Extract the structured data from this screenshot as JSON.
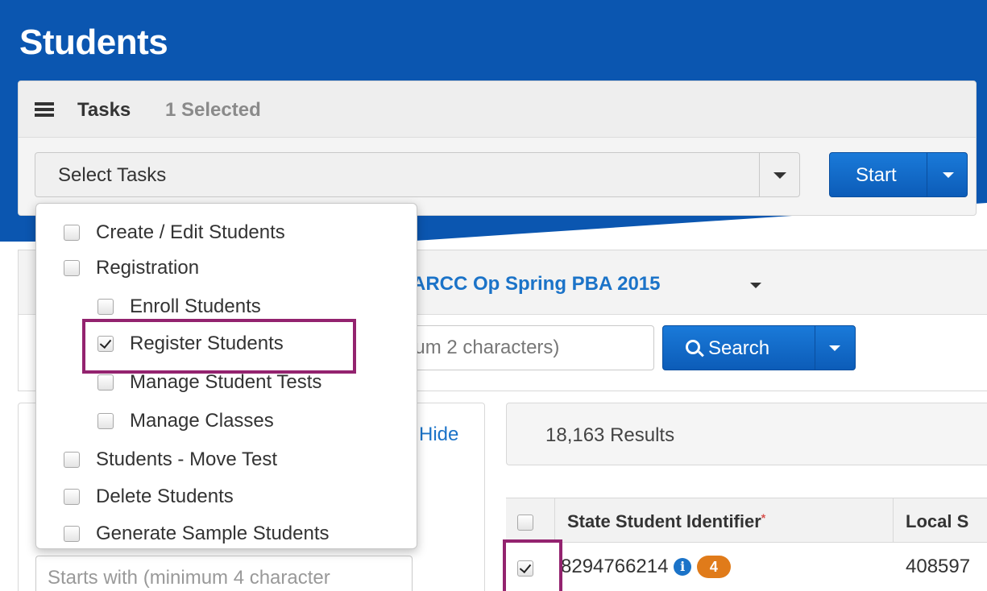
{
  "page": {
    "title": "Students"
  },
  "tasks": {
    "label": "Tasks",
    "selected_count": "1 Selected",
    "select_placeholder": "Select Tasks",
    "start_label": "Start",
    "menu": [
      {
        "label": "Create / Edit Students",
        "checked": false,
        "indent": 0
      },
      {
        "label": "Registration",
        "checked": false,
        "indent": 0
      },
      {
        "label": "Enroll Students",
        "checked": false,
        "indent": 1
      },
      {
        "label": "Register Students",
        "checked": true,
        "indent": 1
      },
      {
        "label": "Manage Student Tests",
        "checked": false,
        "indent": 1
      },
      {
        "label": "Manage Classes",
        "checked": false,
        "indent": 1
      },
      {
        "label": "Students - Move Test",
        "checked": false,
        "indent": 0
      },
      {
        "label": "Delete Students",
        "checked": false,
        "indent": 0
      },
      {
        "label": "Generate Sample Students",
        "checked": false,
        "indent": 0
      }
    ]
  },
  "test_selector": {
    "name": "ARCC Op Spring PBA 2015"
  },
  "search": {
    "placeholder": "num 2 characters)",
    "button_label": "Search"
  },
  "filter": {
    "hide_label": "Hide",
    "input_placeholder": "Starts with (minimum 4 character"
  },
  "results": {
    "count_text": "18,163 Results",
    "columns": [
      {
        "label": "State Student Identifier",
        "required_mark": "*"
      },
      {
        "label": "Local S"
      }
    ],
    "rows": [
      {
        "checked": true,
        "state_id": "8294766214",
        "info_icon": "i",
        "badge": "4",
        "local_id": "408597"
      }
    ]
  },
  "colors": {
    "header_blue": "#0b56b0",
    "button_blue": "#1a7ad9",
    "link_blue": "#1b73c8",
    "badge_orange": "#e07b1a",
    "highlight_purple": "#93236f"
  }
}
